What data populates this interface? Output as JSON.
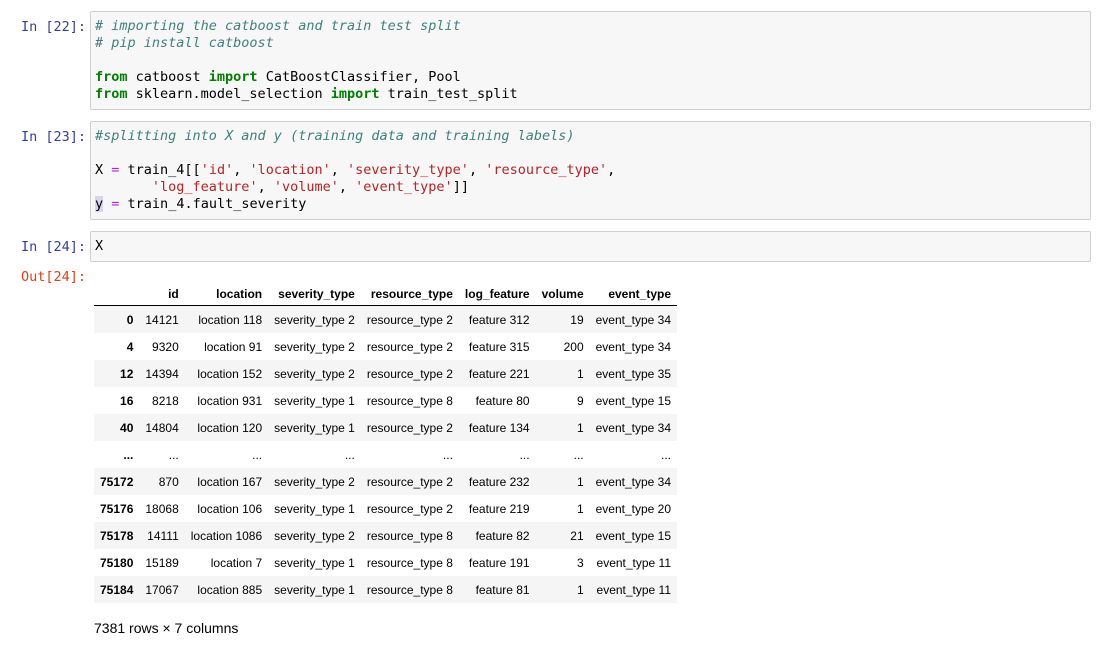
{
  "cells": [
    {
      "prompt": "In [22]:",
      "lines": [
        [
          {
            "t": "# importing the catboost and train test split",
            "c": "cm"
          }
        ],
        [
          {
            "t": "# pip install catboost",
            "c": "cm"
          }
        ],
        [
          {
            "t": "",
            "c": ""
          }
        ],
        [
          {
            "t": "from",
            "c": "kw"
          },
          {
            "t": " catboost ",
            "c": ""
          },
          {
            "t": "import",
            "c": "kw"
          },
          {
            "t": " CatBoostClassifier, Pool",
            "c": ""
          }
        ],
        [
          {
            "t": "from",
            "c": "kw"
          },
          {
            "t": " sklearn.model_selection ",
            "c": ""
          },
          {
            "t": "import",
            "c": "kw"
          },
          {
            "t": " train_test_split",
            "c": ""
          }
        ]
      ]
    },
    {
      "prompt": "In [23]:",
      "lines": [
        [
          {
            "t": "#splitting into X and y (training data and training labels)",
            "c": "cm"
          }
        ],
        [
          {
            "t": "",
            "c": ""
          }
        ],
        [
          {
            "t": "X ",
            "c": ""
          },
          {
            "t": "=",
            "c": "op"
          },
          {
            "t": " train_4[[",
            "c": ""
          },
          {
            "t": "'id'",
            "c": "st"
          },
          {
            "t": ", ",
            "c": ""
          },
          {
            "t": "'location'",
            "c": "st"
          },
          {
            "t": ", ",
            "c": ""
          },
          {
            "t": "'severity_type'",
            "c": "st"
          },
          {
            "t": ", ",
            "c": ""
          },
          {
            "t": "'resource_type'",
            "c": "st"
          },
          {
            "t": ",",
            "c": ""
          }
        ],
        [
          {
            "t": "       ",
            "c": ""
          },
          {
            "t": "'log_feature'",
            "c": "st"
          },
          {
            "t": ", ",
            "c": ""
          },
          {
            "t": "'volume'",
            "c": "st"
          },
          {
            "t": ", ",
            "c": ""
          },
          {
            "t": "'event_type'",
            "c": "st"
          },
          {
            "t": "]]",
            "c": ""
          }
        ],
        [
          {
            "t": "y",
            "c": "cursor-bg"
          },
          {
            "t": " ",
            "c": ""
          },
          {
            "t": "=",
            "c": "op"
          },
          {
            "t": " train_4.fault_severity",
            "c": ""
          }
        ]
      ]
    },
    {
      "prompt": "In [24]:",
      "lines": [
        [
          {
            "t": "X",
            "c": ""
          }
        ]
      ]
    }
  ],
  "output": {
    "prompt": "Out[24]:",
    "columns": [
      "",
      "id",
      "location",
      "severity_type",
      "resource_type",
      "log_feature",
      "volume",
      "event_type"
    ],
    "rows": [
      [
        "0",
        "14121",
        "location 118",
        "severity_type 2",
        "resource_type 2",
        "feature 312",
        "19",
        "event_type 34"
      ],
      [
        "4",
        "9320",
        "location 91",
        "severity_type 2",
        "resource_type 2",
        "feature 315",
        "200",
        "event_type 34"
      ],
      [
        "12",
        "14394",
        "location 152",
        "severity_type 2",
        "resource_type 2",
        "feature 221",
        "1",
        "event_type 35"
      ],
      [
        "16",
        "8218",
        "location 931",
        "severity_type 1",
        "resource_type 8",
        "feature 80",
        "9",
        "event_type 15"
      ],
      [
        "40",
        "14804",
        "location 120",
        "severity_type 1",
        "resource_type 2",
        "feature 134",
        "1",
        "event_type 34"
      ],
      [
        "...",
        "...",
        "...",
        "...",
        "...",
        "...",
        "...",
        "..."
      ],
      [
        "75172",
        "870",
        "location 167",
        "severity_type 2",
        "resource_type 2",
        "feature 232",
        "1",
        "event_type 34"
      ],
      [
        "75176",
        "18068",
        "location 106",
        "severity_type 1",
        "resource_type 2",
        "feature 219",
        "1",
        "event_type 20"
      ],
      [
        "75178",
        "14111",
        "location 1086",
        "severity_type 2",
        "resource_type 8",
        "feature 82",
        "21",
        "event_type 15"
      ],
      [
        "75180",
        "15189",
        "location 7",
        "severity_type 1",
        "resource_type 8",
        "feature 191",
        "3",
        "event_type 11"
      ],
      [
        "75184",
        "17067",
        "location 885",
        "severity_type 1",
        "resource_type 8",
        "feature 81",
        "1",
        "event_type 11"
      ]
    ],
    "shape": "7381 rows × 7 columns"
  }
}
